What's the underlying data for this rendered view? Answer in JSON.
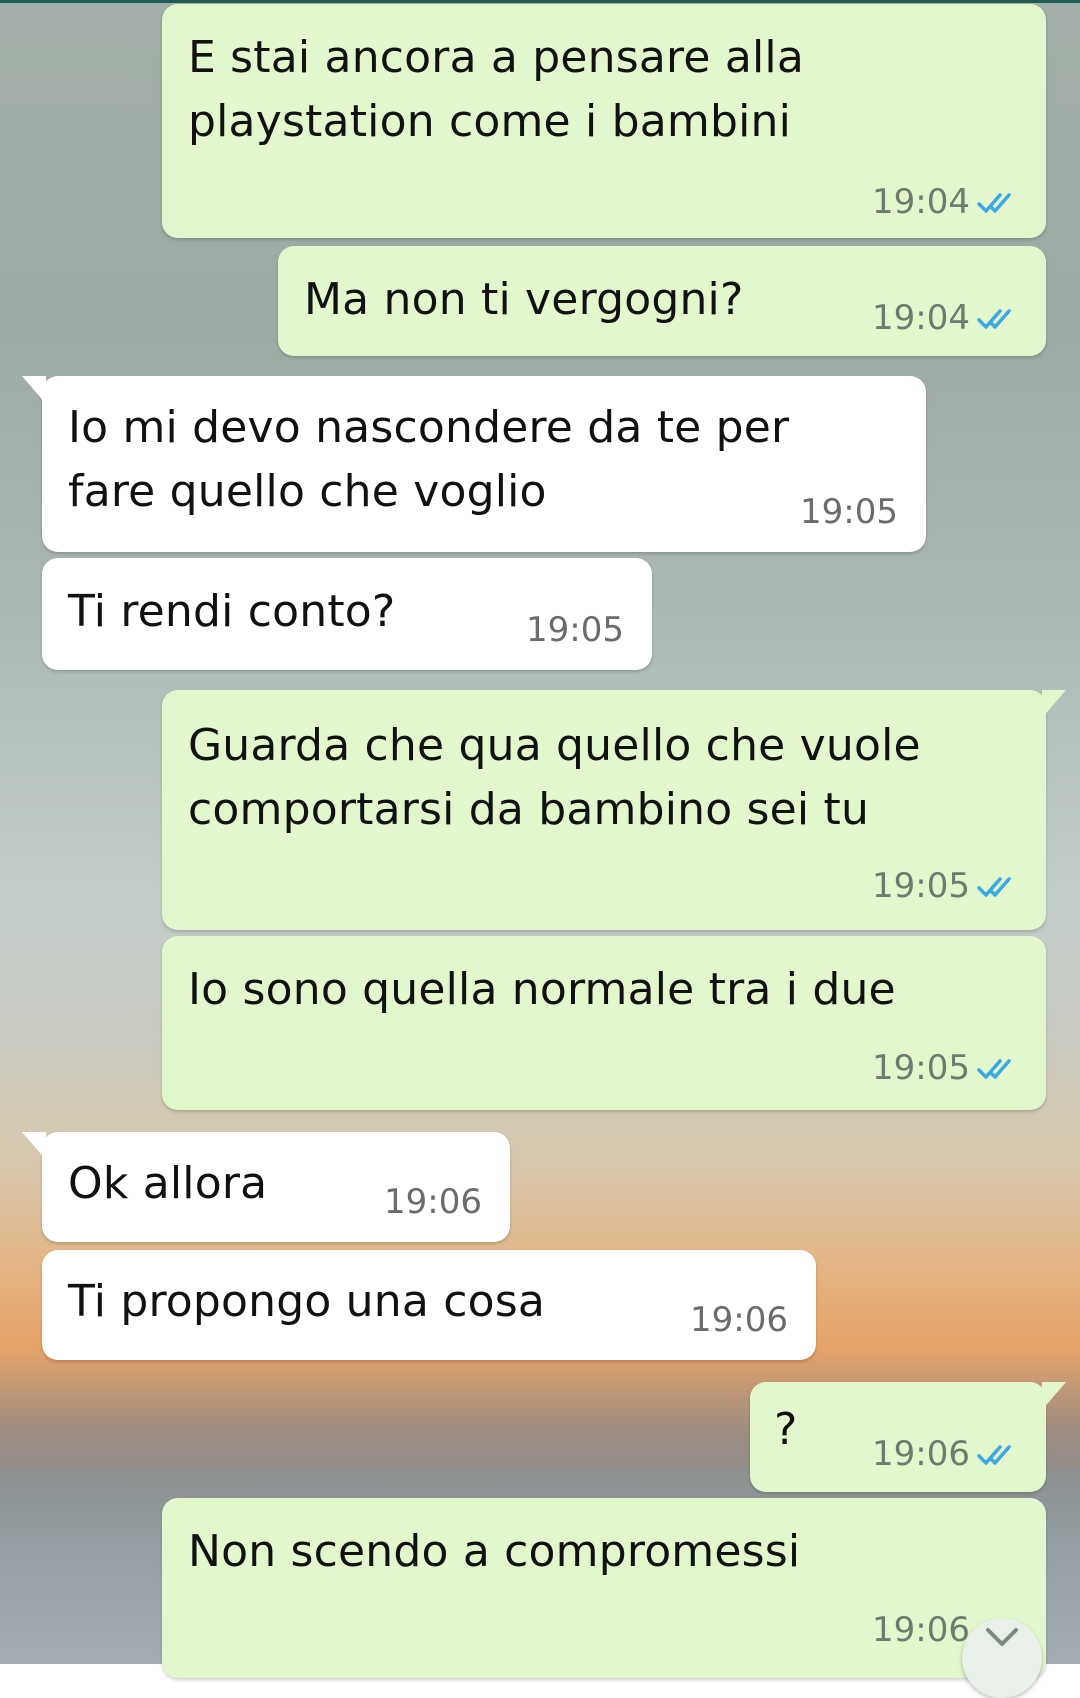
{
  "chat": {
    "messages": [
      {
        "text": "E stai ancora a pensare alla\nplaystation come i bambini",
        "time": "19:04",
        "ticks": "read-double-check-icon"
      },
      {
        "text": "Ma non ti vergogni?",
        "time": "19:04",
        "ticks": "read-double-check-icon"
      },
      {
        "text": "Io mi devo nascondere da te per\nfare quello che voglio",
        "time": "19:05"
      },
      {
        "text": "Ti rendi conto?",
        "time": "19:05"
      },
      {
        "text": "Guarda che qua quello che vuole\ncomportarsi da bambino sei tu",
        "time": "19:05",
        "ticks": "read-double-check-icon"
      },
      {
        "text": "Io sono quella normale tra i due",
        "time": "19:05",
        "ticks": "read-double-check-icon"
      },
      {
        "text": "Ok allora",
        "time": "19:06"
      },
      {
        "text": "Ti propongo una cosa",
        "time": "19:06"
      },
      {
        "text": "?",
        "time": "19:06",
        "ticks": "read-double-check-icon"
      },
      {
        "text": "Non scendo a compromessi",
        "time": "19:06",
        "ticks": "read-double-check-icon"
      }
    ]
  },
  "colors": {
    "outgoing_bubble": "#e2f8cc",
    "incoming_bubble": "#ffffff",
    "read_ticks": "#3aa7e6",
    "timestamp": "#6f7a70"
  },
  "scroll_button": {
    "icon": "chevron-down-icon"
  }
}
